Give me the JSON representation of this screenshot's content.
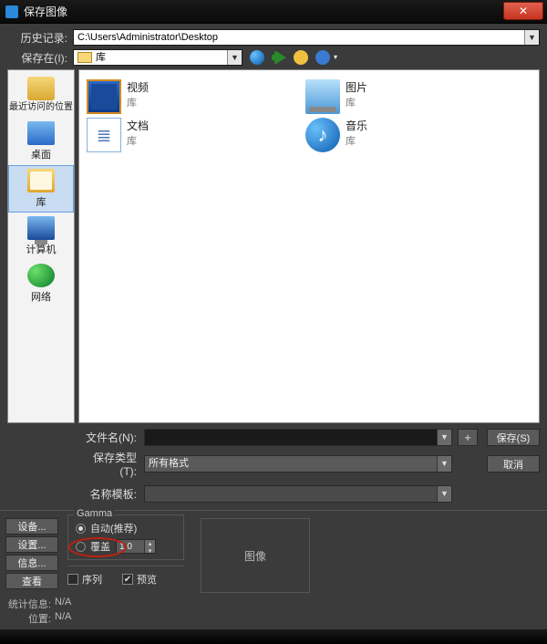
{
  "titlebar": {
    "title": "保存图像",
    "close_glyph": "✕"
  },
  "history": {
    "label": "历史记录:",
    "value": "C:\\Users\\Administrator\\Desktop"
  },
  "savein": {
    "label": "保存在(I):",
    "value": "库"
  },
  "places": {
    "recent": "最近访问的位置",
    "desktop": "桌面",
    "library": "库",
    "computer": "计算机",
    "network": "网络"
  },
  "files": {
    "video": {
      "name": "视频",
      "type": "库"
    },
    "pictures": {
      "name": "图片",
      "type": "库"
    },
    "documents": {
      "name": "文档",
      "type": "库"
    },
    "music": {
      "name": "音乐",
      "type": "库"
    }
  },
  "fields": {
    "filename_label": "文件名(N):",
    "filename_value": "",
    "savetype_label": "保存类型(T):",
    "savetype_value": "所有格式",
    "tpl_label": "名称模板:",
    "tpl_value": "",
    "plus": "+",
    "save_btn": "保存(S)",
    "cancel_btn": "取消"
  },
  "left_buttons": {
    "b1": "设备...",
    "b2": "设置...",
    "b3": "信息...",
    "b4": "查看"
  },
  "gamma": {
    "legend": "Gamma",
    "auto": "自动(推荐)",
    "override": "覆盖",
    "override_value": "1.0"
  },
  "seq": {
    "sequence": "序列",
    "preview": "预览"
  },
  "preview_box": "图像",
  "status": {
    "stats_label": "统计信息:",
    "stats_value": "N/A",
    "pos_label": "位置:",
    "pos_value": "N/A"
  }
}
